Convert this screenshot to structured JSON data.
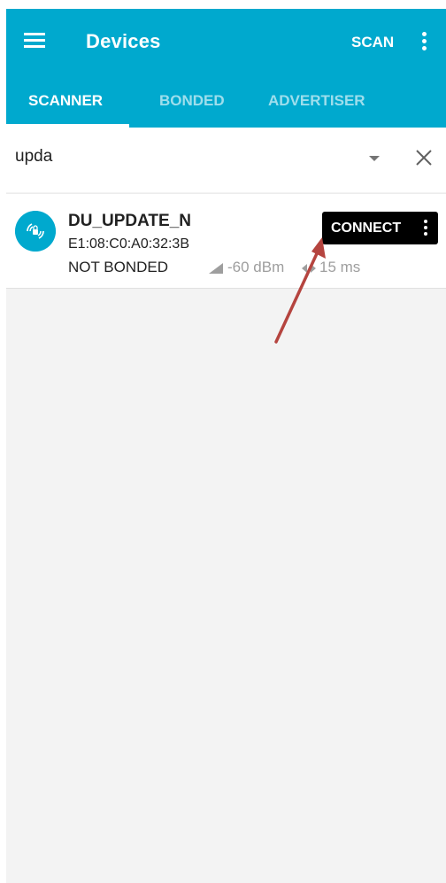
{
  "appbar": {
    "title": "Devices",
    "scan_label": "SCAN",
    "color": "#00a9ce",
    "icons": {
      "menu": "hamburger-menu-icon",
      "overflow": "overflow-menu-icon"
    }
  },
  "tabs": [
    {
      "label": "SCANNER",
      "active": true
    },
    {
      "label": "BONDED",
      "active": false
    },
    {
      "label": "ADVERTISER",
      "active": false
    }
  ],
  "filter": {
    "value": "upda",
    "icons": {
      "dropdown": "dropdown-icon",
      "clear": "close-icon"
    }
  },
  "devices": [
    {
      "name": "DU_UPDATE_N",
      "address": "E1:08:C0:A0:32:3B",
      "bond_state": "NOT BONDED",
      "rssi": "-60 dBm",
      "interval": "15 ms",
      "connect_label": "CONNECT",
      "icons": {
        "avatar": "bluetooth-device-icon",
        "signal": "signal-strength-icon",
        "interval": "interval-icon",
        "overflow": "overflow-menu-icon"
      }
    }
  ],
  "annotation": {
    "type": "arrow",
    "color": "#b5443f"
  }
}
